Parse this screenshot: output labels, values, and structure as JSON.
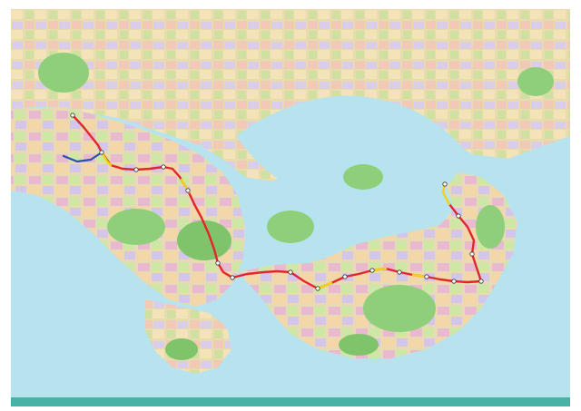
{
  "title": "",
  "colors": {
    "frame": "#ffffff",
    "sea": "#b7e3ee",
    "land": "#e6d8a8",
    "land_alt": "#f0c8b8",
    "green": "#8fcf7a",
    "purple": "#d7c3e6",
    "bottom_bar": "#47b2a6",
    "route_red": "#e3262b",
    "route_yellow": "#f0d21c",
    "route_blue": "#2a4fb0"
  },
  "stations": [
    {
      "name": "",
      "orient": "h"
    }
  ]
}
